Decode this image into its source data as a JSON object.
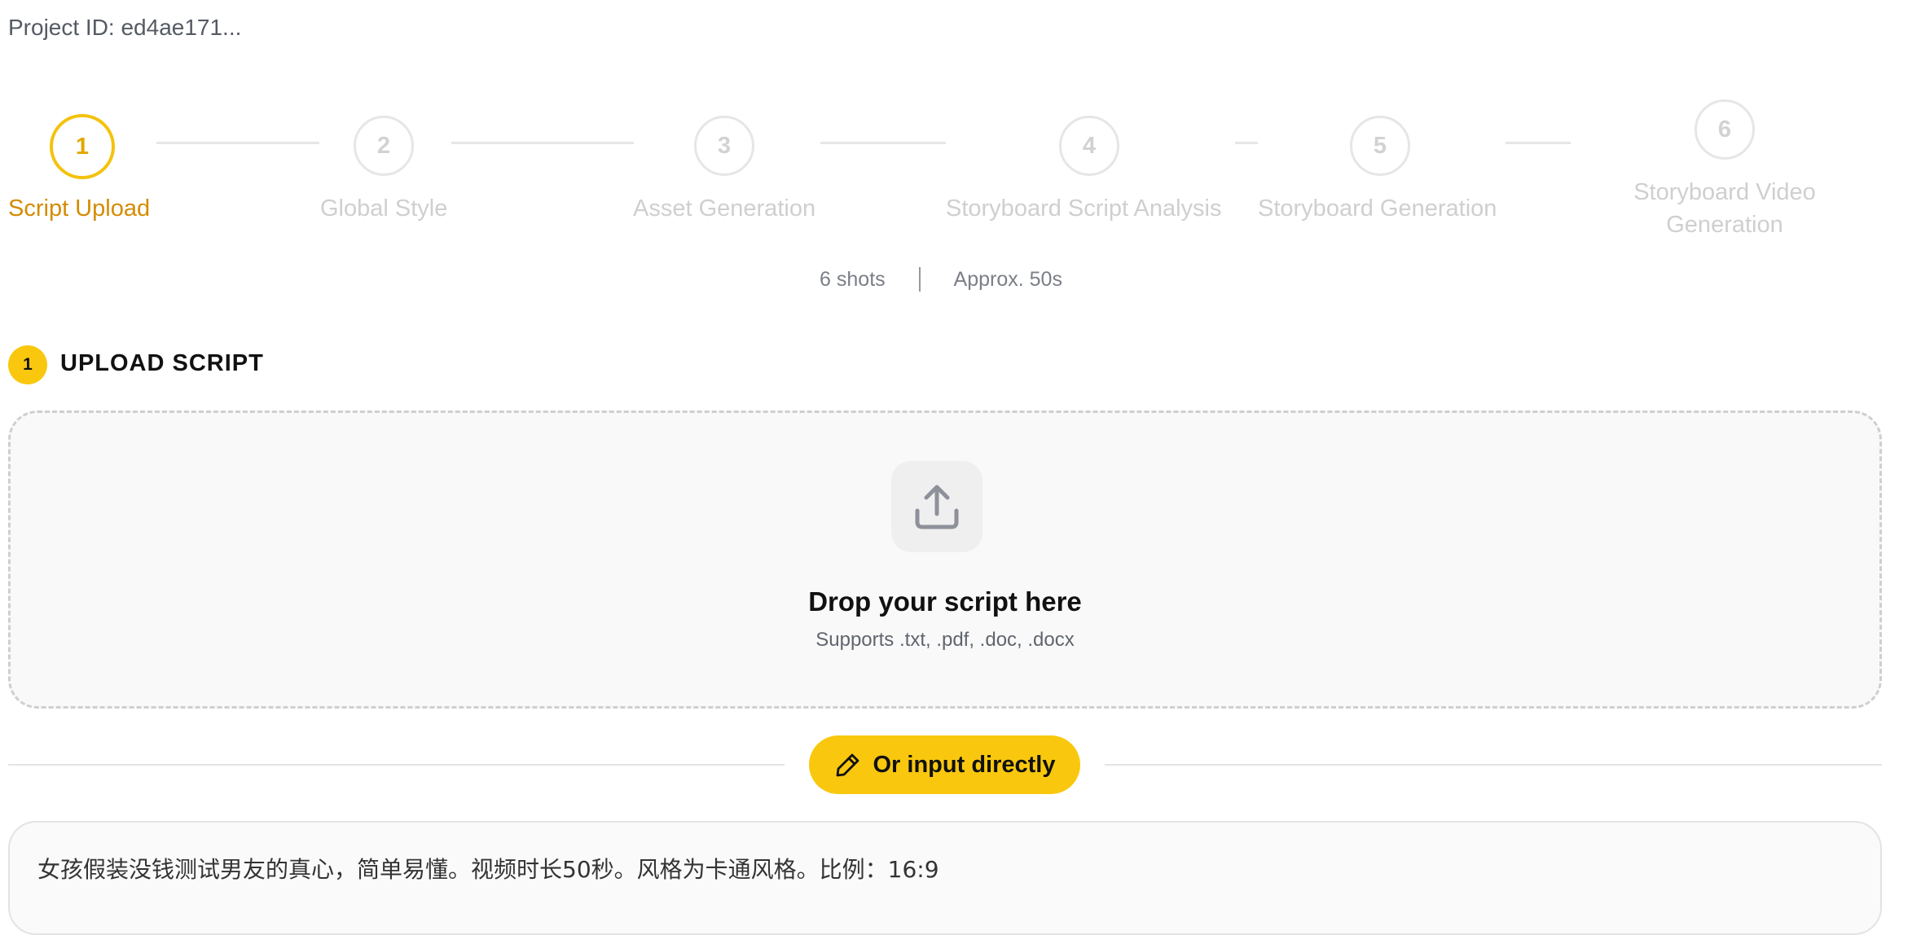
{
  "project": {
    "label": "Project ID: ed4ae171..."
  },
  "stepper": {
    "steps": [
      {
        "number": "1",
        "label": "Script Upload",
        "active": true
      },
      {
        "number": "2",
        "label": "Global Style",
        "active": false
      },
      {
        "number": "3",
        "label": "Asset Generation",
        "active": false
      },
      {
        "number": "4",
        "label": "Storyboard Script Analysis",
        "active": false
      },
      {
        "number": "5",
        "label": "Storyboard Generation",
        "active": false
      },
      {
        "number": "6",
        "label": "Storyboard Video Generation",
        "active": false
      }
    ]
  },
  "summary": {
    "shots": "6 shots",
    "duration": "Approx. 50s"
  },
  "section": {
    "number": "1",
    "title": "UPLOAD SCRIPT"
  },
  "dropzone": {
    "icon": "upload-icon",
    "title": "Drop your script here",
    "subtitle": "Supports .txt, .pdf, .doc, .docx"
  },
  "input_direct": {
    "icon": "pencil-icon",
    "label": "Or input directly"
  },
  "script_input": {
    "value": "女孩假装没钱测试男友的真心，简单易懂。视频时长50秒。风格为卡通风格。比例：16:9"
  },
  "colors": {
    "accent": "#f9c80e",
    "active_step_text": "#d48c00",
    "inactive_step": "#cfcfcf"
  }
}
